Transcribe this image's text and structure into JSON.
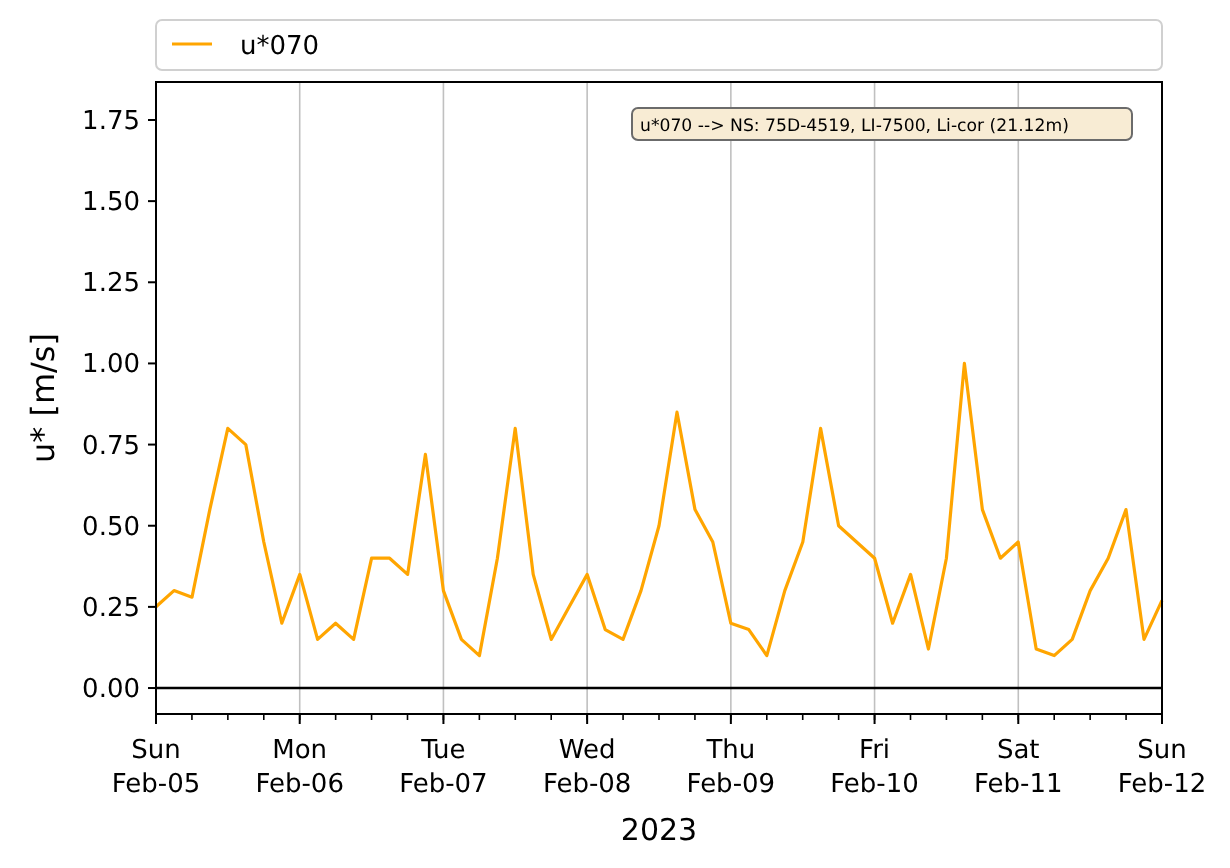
{
  "chart_data": {
    "type": "line",
    "grid": "x",
    "xlabel": "2023",
    "ylabel": "u* [m/s]",
    "categories": [
      "Sun\nFeb-05",
      null,
      null,
      null,
      null,
      null,
      null,
      null,
      "Mon\nFeb-06",
      null,
      null,
      null,
      null,
      null,
      null,
      null,
      "Tue\nFeb-07",
      null,
      null,
      null,
      null,
      null,
      null,
      null,
      "Wed\nFeb-08",
      null,
      null,
      null,
      null,
      null,
      null,
      null,
      "Thu\nFeb-09",
      null,
      null,
      null,
      null,
      null,
      null,
      null,
      "Fri\nFeb-10",
      null,
      null,
      null,
      null,
      null,
      null,
      null,
      "Sat\nFeb-11",
      null,
      null,
      null,
      null,
      null,
      null,
      null,
      "Sun\nFeb-12"
    ],
    "series": [
      {
        "name": "u*070",
        "color": "#ffa500",
        "values": [
          0.25,
          0.3,
          0.28,
          0.55,
          0.8,
          0.75,
          0.45,
          0.2,
          0.35,
          0.15,
          0.2,
          0.15,
          0.4,
          0.4,
          0.35,
          0.72,
          0.3,
          0.15,
          0.1,
          0.4,
          0.8,
          0.35,
          0.15,
          0.25,
          0.35,
          0.18,
          0.15,
          0.3,
          0.5,
          0.85,
          0.55,
          0.45,
          0.2,
          0.18,
          0.1,
          0.3,
          0.45,
          0.8,
          0.5,
          0.45,
          0.4,
          0.2,
          0.35,
          0.12,
          0.4,
          1.0,
          0.55,
          0.4,
          0.45,
          0.12,
          0.1,
          0.15,
          0.3,
          0.4,
          0.55,
          0.15,
          0.27
        ]
      }
    ],
    "ylim": [
      -0.08,
      1.867
    ],
    "yticks": [
      {
        "value": 0,
        "label": "0.00"
      },
      {
        "value": 0.25,
        "label": "0.25"
      },
      {
        "value": 0.5,
        "label": "0.50"
      },
      {
        "value": 0.75,
        "label": "0.75"
      },
      {
        "value": 1,
        "label": "1.00"
      },
      {
        "value": 1.25,
        "label": "1.25"
      },
      {
        "value": 1.5,
        "label": "1.50"
      },
      {
        "value": 1.75,
        "label": "1.75"
      }
    ],
    "annotations": [
      {
        "text": "u*070 --> NS: 75D-4519, LI-7500, Li-cor (21.12m)"
      }
    ]
  }
}
